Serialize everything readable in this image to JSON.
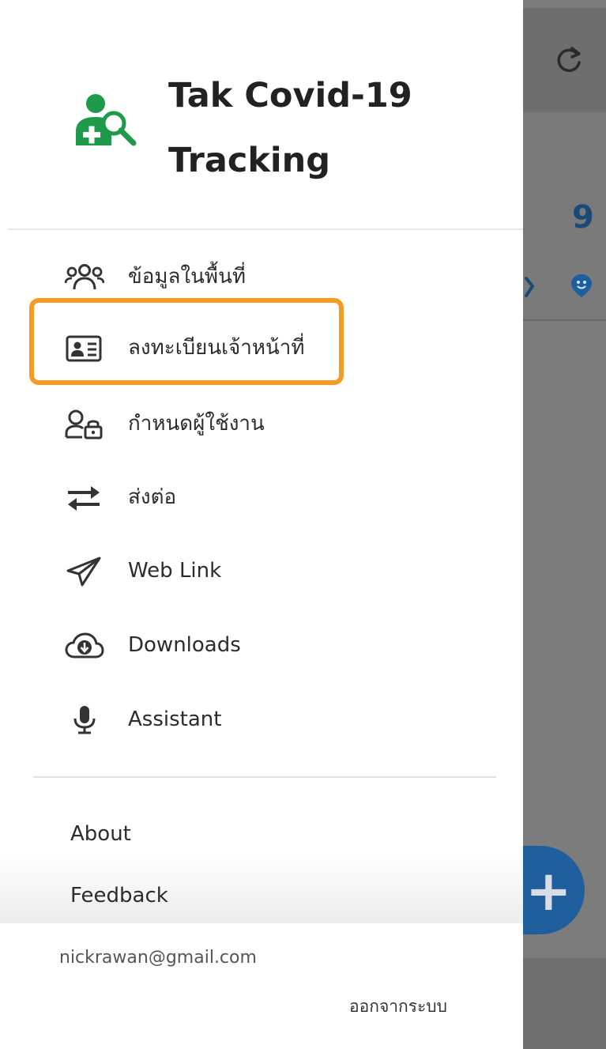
{
  "app": {
    "title": "Tak Covid-19 Tracking"
  },
  "menu": {
    "items": [
      {
        "label": "ข้อมูลในพื้นที่",
        "icon": "people-group-icon"
      },
      {
        "label": "ลงทะเบียนเจ้าหน้าที่",
        "icon": "id-card-icon",
        "highlighted": true
      },
      {
        "label": "กำหนดผู้ใช้งาน",
        "icon": "user-lock-icon"
      },
      {
        "label": "ส่งต่อ",
        "icon": "exchange-arrows-icon"
      },
      {
        "label": "Web Link",
        "icon": "paper-plane-icon"
      },
      {
        "label": "Downloads",
        "icon": "cloud-download-icon"
      },
      {
        "label": "Assistant",
        "icon": "microphone-icon"
      }
    ]
  },
  "links": {
    "about": "About",
    "feedback": "Feedback"
  },
  "account": {
    "email": "nickrawan@gmail.com",
    "logout": "ออกจากระบบ"
  },
  "background": {
    "count": "9",
    "fab": "+"
  },
  "colors": {
    "logo_green": "#1e9a4a",
    "highlight": "#f59a23",
    "background_accent": "#1f5f9e",
    "scrim": "#7c7c7c"
  }
}
